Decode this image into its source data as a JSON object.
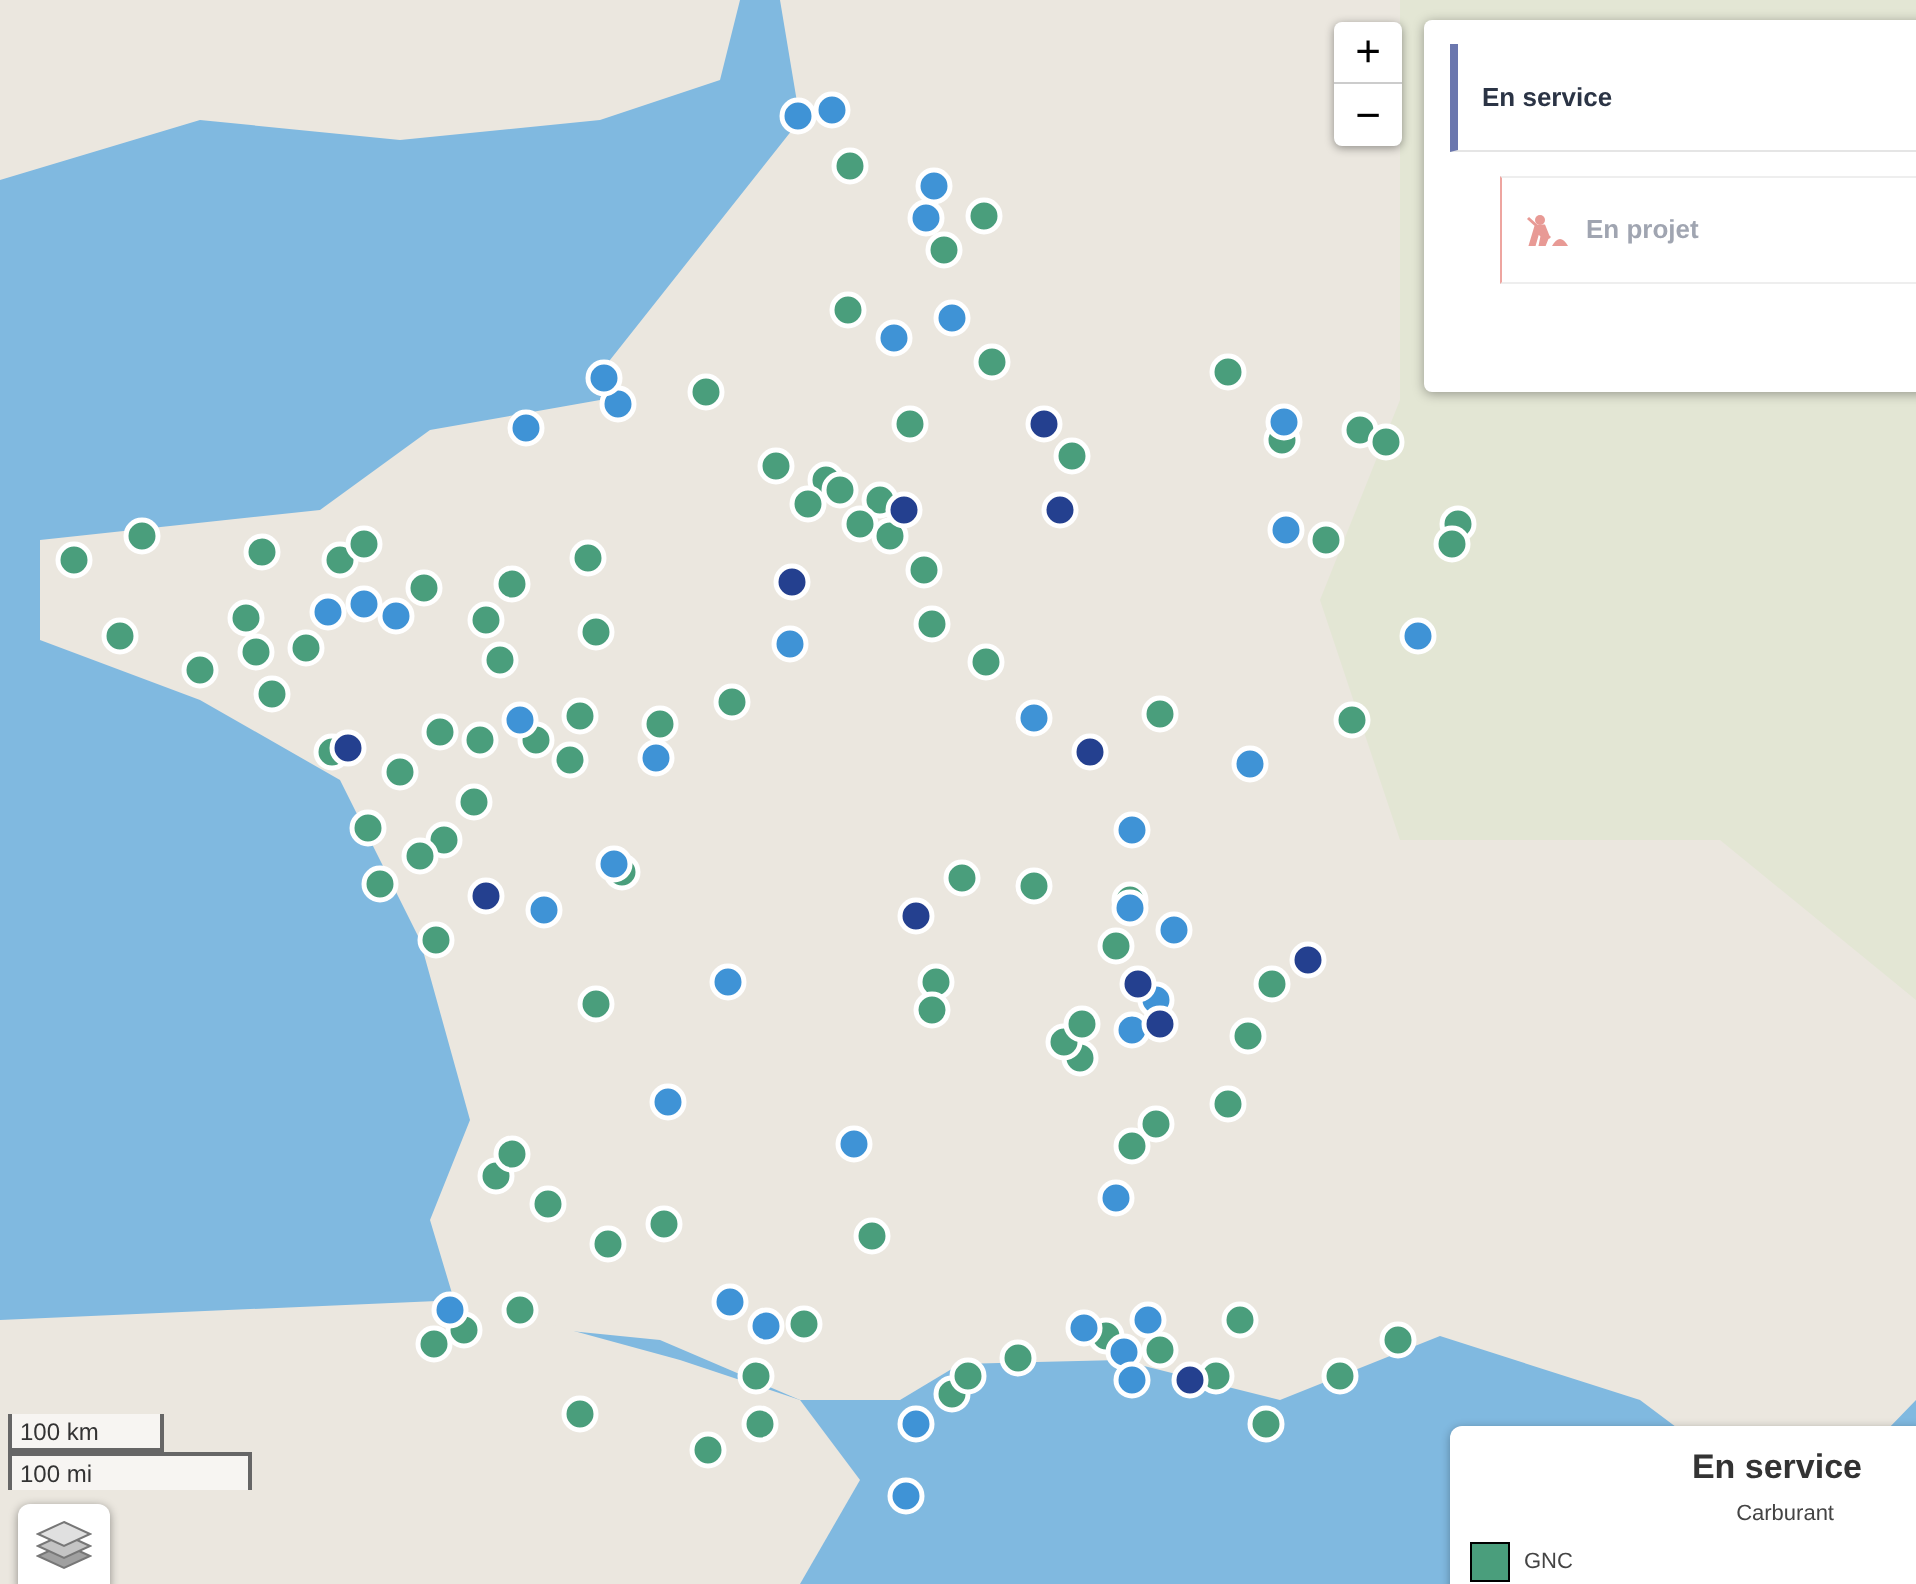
{
  "zoom_controls": {
    "zoom_in": "+",
    "zoom_out": "−"
  },
  "tabs": [
    {
      "label": "En service",
      "selected": true
    },
    {
      "label": "En projet",
      "selected": false
    }
  ],
  "legend": {
    "title": "En service",
    "subtitle": "Carburant",
    "items": [
      {
        "label": "GNC",
        "color": "#4a9e7c"
      }
    ]
  },
  "scale": {
    "metric": "100 km",
    "imperial": "100 mi"
  }
}
